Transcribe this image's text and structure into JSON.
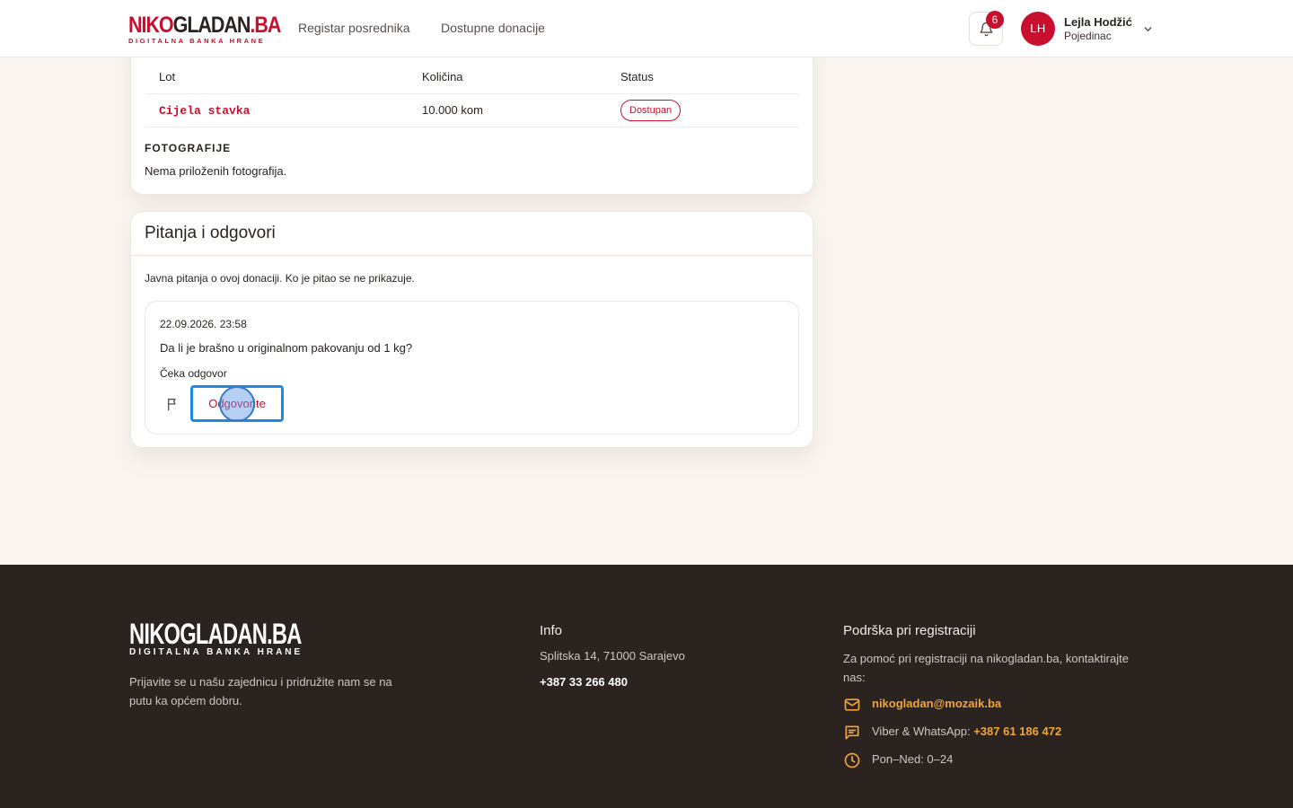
{
  "header": {
    "logo_main_a": "NIKO",
    "logo_main_b": "GLADAN",
    "logo_main_c": ".BA",
    "logo_sub": "DIGITALNA BANKA HRANE",
    "nav": [
      "Registar posrednika",
      "Dostupne donacije"
    ],
    "notification_count": "6",
    "user_initials": "LH",
    "user_name": "Lejla Hodžić",
    "user_role": "Pojedinac"
  },
  "lots": {
    "columns": [
      "Lot",
      "Količina",
      "Status"
    ],
    "rows": [
      {
        "lot": "Cijela stavka",
        "qty": "10.000 kom",
        "status": "Dostupan"
      }
    ],
    "photos_heading": "FOTOGRAFIJE",
    "photos_text": "Nema priloženih fotografija."
  },
  "qa": {
    "title": "Pitanja i odgovori",
    "intro": "Javna pitanja o ovoj donaciji. Ko je pitao se ne prikazuje.",
    "question": {
      "date": "22.09.2026. 23:58",
      "text": "Da li je brašno u originalnom pakovanju od 1 kg?",
      "status": "Čeka odgovor",
      "answer_label": "Odgovorite"
    }
  },
  "footer": {
    "logo_main": "NIKOGLADAN.BA",
    "logo_sub": "DIGITALNA BANKA HRANE",
    "tagline": "Prijavite se u našu zajednicu i pridružite nam se na putu ka općem dobru.",
    "info_heading": "Info",
    "address": "Splitska 14, 71000 Sarajevo",
    "phone": "+387 33 266 480",
    "support_heading": "Podrška pri registraciji",
    "support_text": "Za pomoć pri registraciji na nikogladan.ba, kontaktirajte nas:",
    "email": "nikogladan@mozaik.ba",
    "viber_label": "Viber & WhatsApp: ",
    "viber_number": "+387 61 186 472",
    "hours": "Pon–Ned: 0–24"
  },
  "colors": {
    "brand_red": "#c8102e",
    "footer_bg": "#2b2320",
    "accent_orange": "#f0a53a",
    "focus_blue": "#1e88e5",
    "page_bg": "#faf5f0"
  },
  "icons": [
    "bell-icon",
    "chevron-down-icon",
    "flag-icon",
    "mail-icon",
    "chat-icon",
    "clock-icon"
  ]
}
